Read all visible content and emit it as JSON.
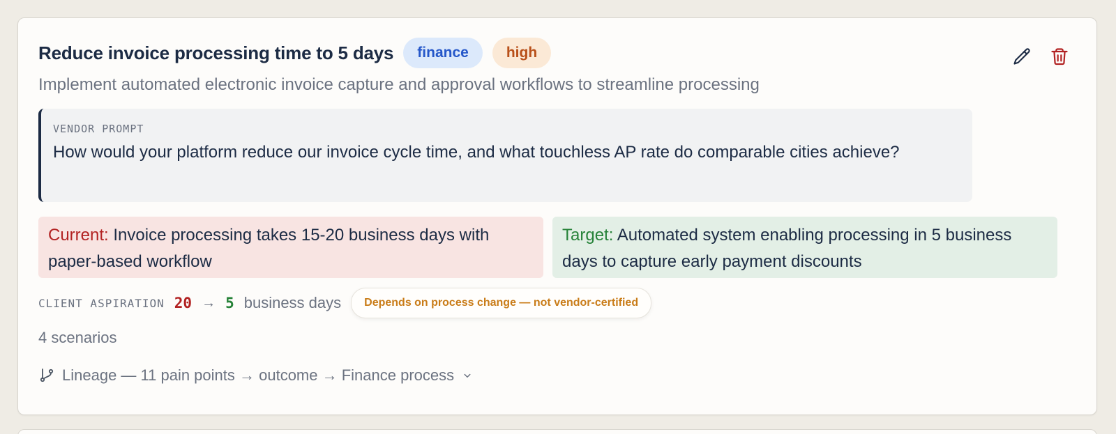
{
  "objective": {
    "title": "Reduce invoice processing time to 5 days",
    "tags": {
      "category": "finance",
      "priority": "high"
    },
    "description": "Implement automated electronic invoice capture and approval workflows to streamline processing",
    "actions": {
      "edit_icon": "pencil-icon",
      "delete_icon": "trash-icon"
    }
  },
  "vendor_prompt": {
    "label": "VENDOR PROMPT",
    "text": "How would your platform reduce our invoice cycle time, and what touchless AP rate do comparable cities achieve?"
  },
  "current_state": {
    "label": "Current:",
    "text": " Invoice processing takes 15-20 business days with paper-based workflow"
  },
  "target_state": {
    "label": "Target:",
    "text": " Automated system enabling processing in 5 business days to capture early payment discounts"
  },
  "aspiration": {
    "label": "CLIENT ASPIRATION",
    "from": "20",
    "arrow": "→",
    "to": "5",
    "unit": "business days",
    "caveat": "Depends on process change — not vendor-certified"
  },
  "scenarios": "4 scenarios",
  "lineage": {
    "icon": "git-branch-icon",
    "text": "Lineage — 11 pain points → outcome → Finance process",
    "chevron_icon": "chevron-down-icon"
  },
  "colors": {
    "title": "#1c2b44",
    "finance_badge_bg": "#dce9fb",
    "finance_badge_text": "#2557c9",
    "priority_badge_bg": "#fbe9d6",
    "priority_badge_text": "#b8501a",
    "current": "#b22222",
    "target": "#268238",
    "delete": "#b22222",
    "caveat": "#c97c18"
  }
}
